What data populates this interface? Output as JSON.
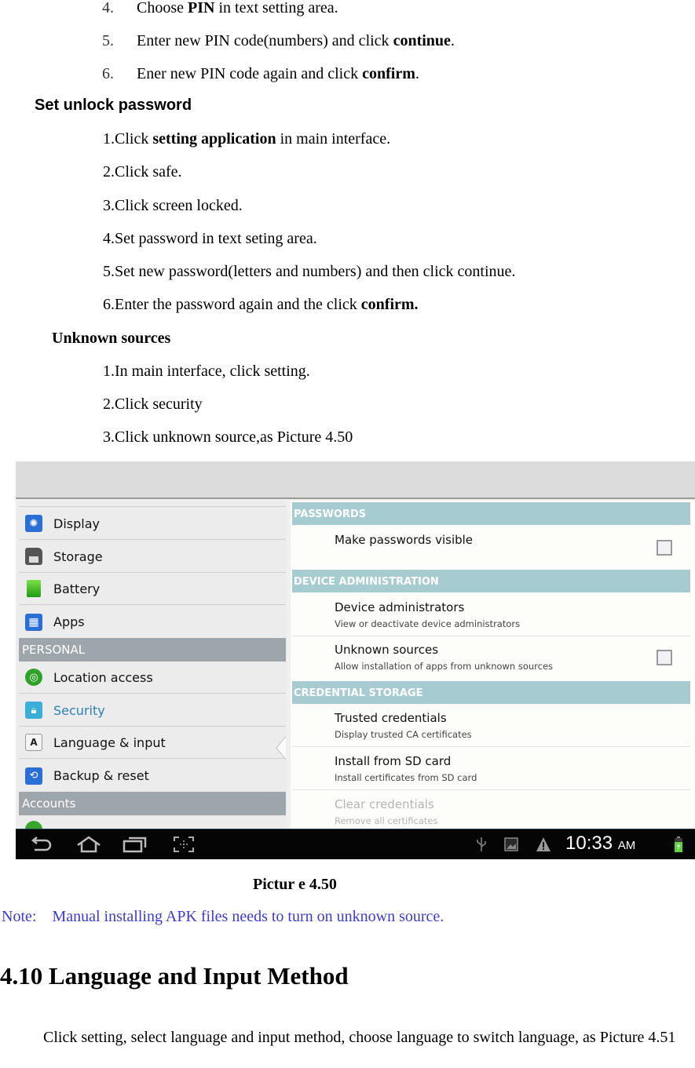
{
  "pin_steps": [
    {
      "num": "4.",
      "pre": "Choose ",
      "bold": "PIN",
      "post": " in text setting area."
    },
    {
      "num": "5.",
      "pre": "Enter new PIN code(numbers) and click ",
      "bold": "continue",
      "post": "."
    },
    {
      "num": "6.",
      "pre": "Ener new PIN code again and click ",
      "bold": "confirm",
      "post": "."
    }
  ],
  "unlock_password": {
    "heading": "Set unlock password",
    "steps": [
      {
        "pre": "1.Click ",
        "bold": "setting application",
        "post": " in main interface."
      },
      {
        "pre": "2.Click safe.",
        "bold": "",
        "post": ""
      },
      {
        "pre": "3.Click screen locked.",
        "bold": "",
        "post": ""
      },
      {
        "pre": "4.Set password in text seting area.",
        "bold": "",
        "post": ""
      },
      {
        "pre": "5.Set new password(letters and numbers) and then click continue.",
        "bold": "",
        "post": ""
      },
      {
        "pre": "6.Enter the password again and the click ",
        "bold": "confirm.",
        "post": ""
      }
    ]
  },
  "unknown_sources": {
    "heading": "Unknown sources",
    "steps": [
      "1.In main interface, click setting.",
      "2.Click security",
      "3.Click unknown source,as Picture 4.50"
    ]
  },
  "screenshot": {
    "left_items": [
      {
        "label": "Display",
        "icon": "display-icon"
      },
      {
        "label": "Storage",
        "icon": "storage-icon"
      },
      {
        "label": "Battery",
        "icon": "battery-icon"
      },
      {
        "label": "Apps",
        "icon": "apps-icon"
      }
    ],
    "personal_header": "PERSONAL",
    "personal_items": [
      {
        "label": "Location access",
        "icon": "location-icon"
      },
      {
        "label": "Security",
        "icon": "lock-icon",
        "active": true
      },
      {
        "label": "Language & input",
        "icon": "language-icon"
      },
      {
        "label": "Backup & reset",
        "icon": "backup-icon"
      }
    ],
    "accounts_header": "Accounts",
    "sections": {
      "passwords": "PASSWORDS",
      "device_admin": "DEVICE ADMINISTRATION",
      "credential_storage": "CREDENTIAL STORAGE"
    },
    "items": {
      "make_visible": {
        "title": "Make passwords visible",
        "checked": false
      },
      "device_admins": {
        "title": "Device administrators",
        "summary": "View or deactivate device administrators"
      },
      "unknown_sources": {
        "title": "Unknown sources",
        "summary": "Allow installation of apps from unknown sources",
        "checked": false
      },
      "trusted": {
        "title": "Trusted credentials",
        "summary": "Display trusted CA certificates"
      },
      "install_sd": {
        "title": "Install from SD card",
        "summary": "Install certificates from SD card"
      },
      "clear": {
        "title": "Clear credentials",
        "summary": "Remove all certificates"
      }
    },
    "status": {
      "time": "10:33",
      "ampm": "AM"
    },
    "colors": {
      "section_header": "#a6ccd2",
      "left_header": "#9ea6ab",
      "active_text": "#2b7fb8",
      "navbar": "#050505"
    }
  },
  "caption": "Pictur e 4.50",
  "note": {
    "label": "Note:",
    "text": "Manual installing APK files needs to turn on unknown source."
  },
  "section_heading": "4.10 Language and Input Method",
  "paragraph": "Click setting, select language and input method, choose language to switch language, as Picture 4.51"
}
